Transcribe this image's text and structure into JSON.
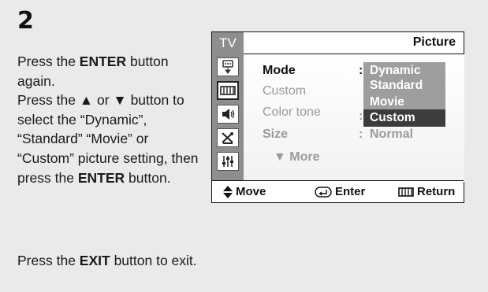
{
  "step": {
    "number": "2"
  },
  "instructions": {
    "line1_pre": "Press the ",
    "line1_key": "ENTER",
    "line1_post": " button again.",
    "line2_pre": "Press the ▲ or ▼ button to select the “Dynamic”, “Standard” “Movie” or “Custom” picture setting, then press the ",
    "line2_key": "ENTER",
    "line2_post": " button."
  },
  "exit_note": {
    "pre": "Press the ",
    "key": "EXIT",
    "post": " button to exit."
  },
  "osd": {
    "tv_label": "TV",
    "title": "Picture",
    "sidebar_icons": [
      "input-icon",
      "picture-icon",
      "sound-icon",
      "channel-icon",
      "setup-icon"
    ],
    "menu": [
      {
        "label": "Mode",
        "colon": ":",
        "value": ""
      },
      {
        "label": "Custom",
        "colon": "",
        "value": ""
      },
      {
        "label": "Color tone",
        "colon": ":",
        "value": ""
      },
      {
        "label": "Size",
        "colon": ":",
        "value": "Normal"
      }
    ],
    "more": "▼ More",
    "dropdown": [
      "Dynamic",
      "Standard",
      "Movie",
      "Custom"
    ],
    "dropdown_selected": "Custom",
    "footer": {
      "move": "Move",
      "enter": "Enter",
      "return": "Return"
    }
  },
  "colors": {
    "panel_bg": "#eaeaea",
    "sidebar": "#8e8e8e",
    "dropdown_bg": "#9e9e9e",
    "dropdown_selected": "#3c3c3c"
  }
}
